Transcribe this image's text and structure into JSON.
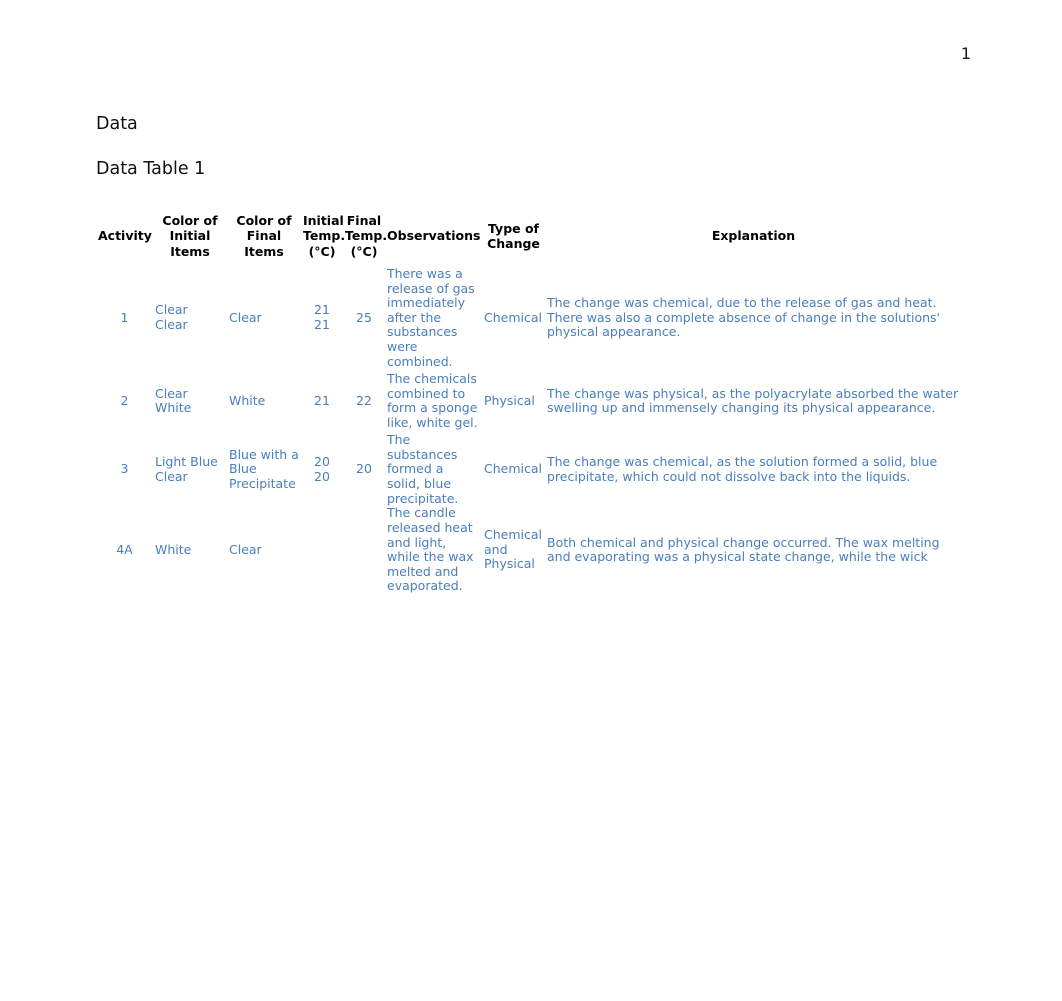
{
  "page": {
    "number": "1"
  },
  "headings": {
    "section": "Data",
    "table_title": "Data Table 1"
  },
  "table": {
    "columns": [
      {
        "key": "activity",
        "label": "Activity"
      },
      {
        "key": "initial_items",
        "label": "Color of Initial Items"
      },
      {
        "key": "final_items",
        "label": "Color of Final Items"
      },
      {
        "key": "initial_temp",
        "label": "Initial Temp. (°C)"
      },
      {
        "key": "final_temp",
        "label": "Final Temp. (°C)"
      },
      {
        "key": "observations",
        "label": "Observations"
      },
      {
        "key": "type_change",
        "label": "Type of Change"
      },
      {
        "key": "explanation",
        "label": "Explanation"
      }
    ],
    "rows": [
      {
        "activity": "1",
        "initial_items": "Clear\nClear",
        "final_items": "Clear",
        "initial_temp": "21\n21",
        "final_temp": "25",
        "observations": "There was a release of gas immediately after the substances were combined.",
        "type_change": "Chemical",
        "explanation": "The change was chemical, due to the release of gas and heat. There was also a complete absence of change in the solutions' physical appearance."
      },
      {
        "activity": "2",
        "initial_items": "Clear\nWhite",
        "final_items": "White",
        "initial_temp": "21",
        "final_temp": "22",
        "observations": "The chemicals combined to form a sponge like, white gel.",
        "type_change": "Physical",
        "explanation": "The change was physical, as the polyacrylate absorbed the water swelling up and immensely changing its physical appearance."
      },
      {
        "activity": "3",
        "initial_items": "Light Blue\nClear",
        "final_items": "Blue with a Blue Precipitate",
        "initial_temp": "20\n20",
        "final_temp": "20",
        "observations": "The substances formed a solid, blue precipitate.",
        "type_change": "Chemical",
        "explanation": "The change was chemical, as the solution formed a solid, blue precipitate, which could not dissolve back into the liquids."
      },
      {
        "activity": "4A",
        "initial_items": "White",
        "final_items": "Clear",
        "initial_temp": "",
        "final_temp": "",
        "observations": "The candle released heat and light, while the wax melted and evaporated.",
        "type_change": "Chemical and Physical",
        "explanation": "Both chemical and physical change occurred. The wax melting and evaporating was a physical state change, while the wick"
      }
    ]
  },
  "colors": {
    "data_text": "#4A7EBB",
    "heading_text": "#111111",
    "page_background": "#FFFFFF"
  }
}
